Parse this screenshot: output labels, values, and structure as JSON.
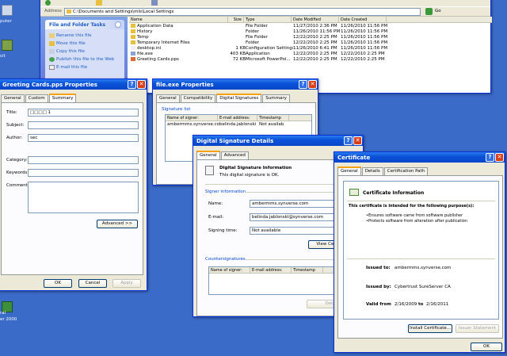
{
  "desktop": {
    "icon_labels": [
      "puter",
      "cit",
      "ral",
      "er 2000"
    ]
  },
  "explorer": {
    "address_label": "Address",
    "address_value": "C:\\Documents and Settings\\mls\\Local Settings",
    "go_label": "Go",
    "tasks": {
      "title": "File and Folder Tasks",
      "items": [
        "Rename this file",
        "Move this file",
        "Copy this file",
        "Publish this file to the Web",
        "E-mail this file"
      ]
    },
    "columns": [
      "Name",
      "Size",
      "Type",
      "Date Modified",
      "Date Created"
    ],
    "rows": [
      {
        "name": "Application Data",
        "size": "",
        "type": "File Folder",
        "modified": "11/27/2010 2:36 PM",
        "created": "11/26/2010 11:56 PM"
      },
      {
        "name": "History",
        "size": "",
        "type": "Folder",
        "modified": "11/26/2010 11:56 PM",
        "created": "11/26/2010 11:56 PM"
      },
      {
        "name": "Temp",
        "size": "",
        "type": "File Folder",
        "modified": "12/22/2010 2:25 PM",
        "created": "11/26/2010 11:56 PM"
      },
      {
        "name": "Temporary Internet Files",
        "size": "",
        "type": "Folder",
        "modified": "12/22/2010 2:25 PM",
        "created": "11/26/2010 11:56 PM"
      },
      {
        "name": "desktop.ini",
        "size": "1 KB",
        "type": "Configuration Settings",
        "modified": "11/26/2010 6:41 PM",
        "created": "11/26/2010 11:56 PM"
      },
      {
        "name": "file.exe",
        "size": "403 KB",
        "type": "Application",
        "modified": "12/22/2010 2:25 PM",
        "created": "12/22/2010 2:25 PM"
      },
      {
        "name": "Greeting Cards.pps",
        "size": "72 KB",
        "type": "Microsoft PowerPoi...",
        "modified": "12/22/2010 2:25 PM",
        "created": "12/22/2010 2:25 PM"
      }
    ]
  },
  "greeting": {
    "title": "Greeting Cards.pps Properties",
    "tabs": [
      "General",
      "Custom",
      "Summary"
    ],
    "fields": [
      {
        "label": "Title:",
        "value": "□□□□ 1"
      },
      {
        "label": "Subject:",
        "value": ""
      },
      {
        "label": "Author:",
        "value": "sec"
      },
      {
        "label": "Category:",
        "value": ""
      },
      {
        "label": "Keywords:",
        "value": ""
      },
      {
        "label": "Comments:",
        "value": ""
      }
    ],
    "advanced": "Advanced >>",
    "ok": "OK",
    "cancel": "Cancel",
    "apply": "Apply"
  },
  "fileexe": {
    "title": "file.exe Properties",
    "tabs": [
      "General",
      "Compatibility",
      "Digital Signatures",
      "Summary"
    ],
    "sig_list_label": "Signature list",
    "columns": [
      "Name of signer:",
      "E-mail address:",
      "Timestamp"
    ],
    "row": {
      "name": "ambermms.synverse.com",
      "email": "belinda.jablonski",
      "timestamp": "Not availab"
    }
  },
  "dsd": {
    "title": "Digital Signature Details",
    "tabs": [
      "General",
      "Advanced"
    ],
    "info_title": "Digital Signature Information",
    "info_sub": "This digital signature is OK.",
    "signer_group": "Signer information",
    "name_label": "Name:",
    "name_value": "ambermms.synverse.com",
    "email_label": "E-mail:",
    "email_value": "belinda.jablonski@synverse.com",
    "time_label": "Signing time:",
    "time_value": "Not available",
    "view_cert": "View Certificate",
    "counter_group": "Countersignatures",
    "counter_cols": [
      "Name of signer:",
      "E-mail address:",
      "Timestamp"
    ],
    "details": "Details"
  },
  "cert": {
    "title": "Certificate",
    "tabs": [
      "General",
      "Details",
      "Certification Path"
    ],
    "info_title": "Certificate Information",
    "purpose": "This certificate is intended for the following purpose(s):",
    "bullets": [
      "Ensures software came from software publisher",
      "Protects software from alteration after publication"
    ],
    "issued_to_label": "Issued to:",
    "issued_to": "ambermms.synverse.com",
    "issued_by_label": "Issued by:",
    "issued_by": "Cybertrust SureServer CA",
    "valid_label": "Valid from",
    "valid_from": "2/16/2009",
    "valid_to_word": "to",
    "valid_to": "2/16/2011",
    "install": "Install Certificate...",
    "issuer_stmt": "Issuer Statement",
    "ok": "OK"
  }
}
